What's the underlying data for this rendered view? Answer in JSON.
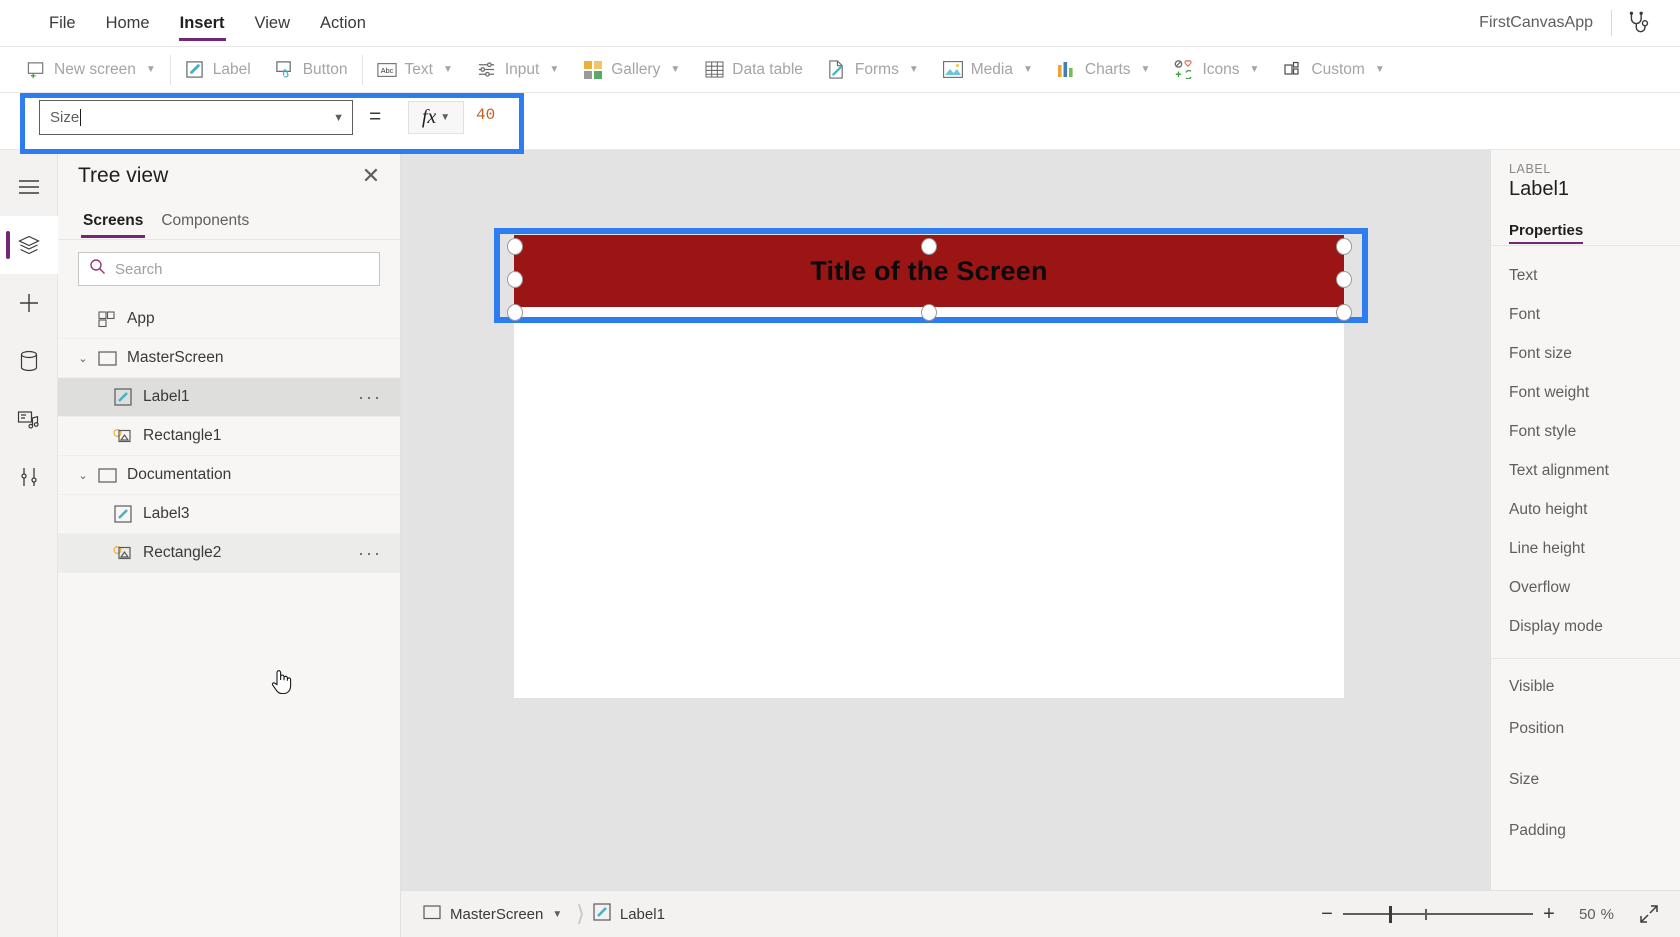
{
  "menubar": {
    "items": [
      {
        "label": "File",
        "active": false
      },
      {
        "label": "Home",
        "active": false
      },
      {
        "label": "Insert",
        "active": true
      },
      {
        "label": "View",
        "active": false
      },
      {
        "label": "Action",
        "active": false
      }
    ],
    "app_title": "FirstCanvasApp",
    "right_icon": "stethoscope-icon"
  },
  "ribbon": {
    "items": [
      {
        "label": "New screen",
        "icon": "new-screen-icon",
        "caret": true
      },
      {
        "label": "Label",
        "icon": "label-icon",
        "caret": false
      },
      {
        "label": "Button",
        "icon": "button-icon",
        "caret": false
      },
      {
        "label": "Text",
        "icon": "text-icon",
        "caret": true
      },
      {
        "label": "Input",
        "icon": "input-icon",
        "caret": true
      },
      {
        "label": "Gallery",
        "icon": "gallery-icon",
        "caret": true
      },
      {
        "label": "Data table",
        "icon": "data-table-icon",
        "caret": false
      },
      {
        "label": "Forms",
        "icon": "forms-icon",
        "caret": true
      },
      {
        "label": "Media",
        "icon": "media-icon",
        "caret": true
      },
      {
        "label": "Charts",
        "icon": "charts-icon",
        "caret": true
      },
      {
        "label": "Icons",
        "icon": "icons-icon",
        "caret": true
      },
      {
        "label": "Custom",
        "icon": "custom-icon",
        "caret": true
      }
    ]
  },
  "formula_bar": {
    "property": "Size",
    "equals": "=",
    "fx_label": "fx",
    "value": "40"
  },
  "rail": {
    "items": [
      {
        "name": "hamburger-icon",
        "active": false
      },
      {
        "name": "tree-view-icon",
        "active": true
      },
      {
        "name": "insert-icon",
        "active": false
      },
      {
        "name": "data-icon",
        "active": false
      },
      {
        "name": "media-icon",
        "active": false
      },
      {
        "name": "advanced-tools-icon",
        "active": false
      }
    ]
  },
  "tree_panel": {
    "title": "Tree view",
    "close_label": "✕",
    "tabs": [
      {
        "label": "Screens",
        "active": true
      },
      {
        "label": "Components",
        "active": false
      }
    ],
    "search_placeholder": "Search",
    "search_value": "",
    "nodes": [
      {
        "label": "App",
        "icon": "app-icon",
        "indent": 0,
        "chevron": "",
        "state": "",
        "dots": false
      },
      {
        "label": "MasterScreen",
        "icon": "screen-icon",
        "indent": 1,
        "chevron": "⌄",
        "state": "",
        "dots": false
      },
      {
        "label": "Label1",
        "icon": "label-icon",
        "indent": 2,
        "chevron": "",
        "state": "sel",
        "dots": true
      },
      {
        "label": "Rectangle1",
        "icon": "rectangle-icon",
        "indent": 2,
        "chevron": "",
        "state": "",
        "dots": false
      },
      {
        "label": "Documentation",
        "icon": "screen-icon",
        "indent": 1,
        "chevron": "⌄",
        "state": "",
        "dots": false
      },
      {
        "label": "Label3",
        "icon": "label-icon",
        "indent": 2,
        "chevron": "",
        "state": "",
        "dots": false
      },
      {
        "label": "Rectangle2",
        "icon": "rectangle-icon",
        "indent": 2,
        "chevron": "",
        "state": "hover",
        "dots": true
      }
    ]
  },
  "canvas": {
    "label_text": "Title of the Screen",
    "label_fill": "#9b1515",
    "label_text_color": "#0b0b0b",
    "selection_color": "#2d7df0",
    "screen_background": "#ffffff"
  },
  "properties_panel": {
    "kind": "LABEL",
    "name": "Label1",
    "tab": "Properties",
    "rows_group1": [
      "Text",
      "Font",
      "Font size",
      "Font weight",
      "Font style",
      "Text alignment",
      "Auto height",
      "Line height",
      "Overflow",
      "Display mode"
    ],
    "rows_group2": [
      "Visible",
      "Position",
      "Size",
      "Padding"
    ]
  },
  "status_bar": {
    "breadcrumb": [
      {
        "label": "MasterScreen",
        "icon": "screen-icon",
        "caret": true
      },
      {
        "label": "Label1",
        "icon": "label-icon",
        "caret": false
      }
    ],
    "zoom_out": "−",
    "zoom_in": "+",
    "zoom_level": "50",
    "zoom_unit": "%",
    "fit_icon": "fit-screen-icon"
  }
}
